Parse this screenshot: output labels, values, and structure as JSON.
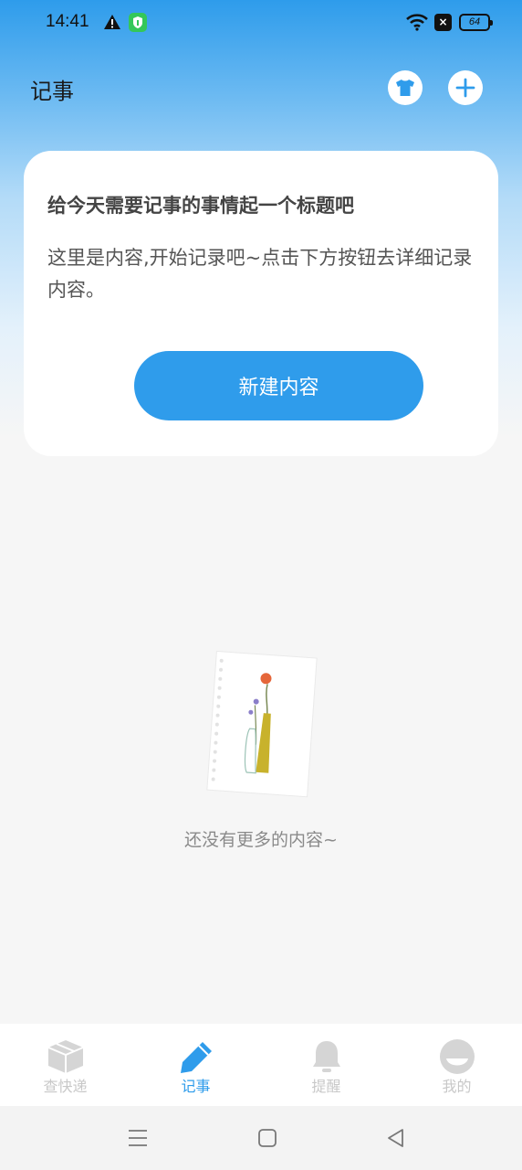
{
  "status_bar": {
    "time": "14:41",
    "battery": "64",
    "icons": [
      "warning-icon",
      "shield-icon",
      "wifi-icon",
      "x-icon",
      "battery-icon"
    ]
  },
  "header": {
    "title": "记事",
    "actions": [
      "tshirt-icon",
      "plus-icon"
    ]
  },
  "card": {
    "title": "给今天需要记事的事情起一个标题吧",
    "body": "这里是内容,开始记录吧~点击下方按钮去详细记录内容。",
    "button_label": "新建内容"
  },
  "empty_state": {
    "text": "还没有更多的内容~"
  },
  "bottom_nav": {
    "items": [
      {
        "label": "查快递",
        "icon": "package-icon",
        "active": false
      },
      {
        "label": "记事",
        "icon": "pencil-icon",
        "active": true
      },
      {
        "label": "提醒",
        "icon": "bell-icon",
        "active": false
      },
      {
        "label": "我的",
        "icon": "profile-icon",
        "active": false
      }
    ]
  },
  "colors": {
    "accent": "#2f9ceb",
    "inactive": "#c8c8c8",
    "background": "#f6f6f6"
  }
}
